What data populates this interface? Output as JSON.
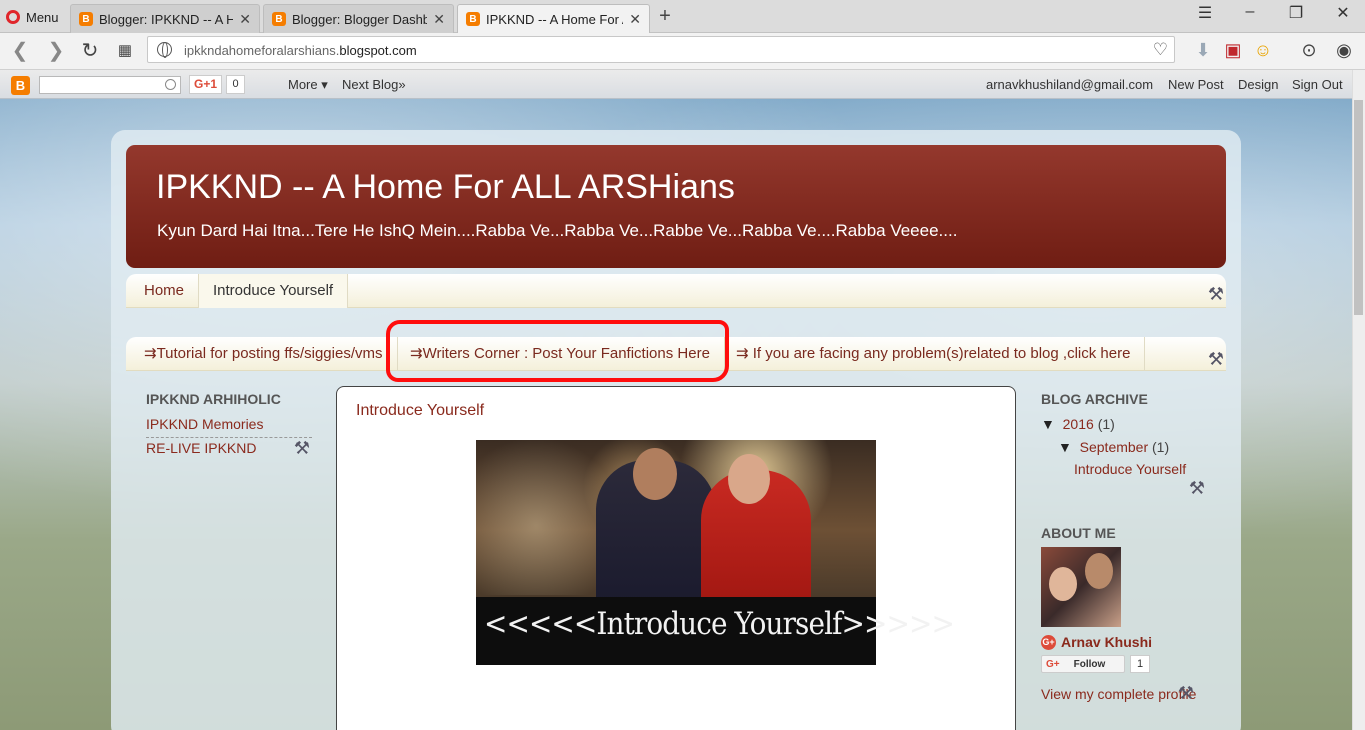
{
  "browser": {
    "menu_label": "Menu",
    "tabs": [
      {
        "title": "Blogger: IPKKND -- A Home For ALL ARSHians",
        "active": false
      },
      {
        "title": "Blogger: Blogger Dashboard",
        "active": false
      },
      {
        "title": "IPKKND -- A Home For ALL ARSHians",
        "active": true
      }
    ],
    "url_prefix": "ipkkndahomeforalarshians.",
    "url_domain": "blogspot.com",
    "icons": [
      "back-icon",
      "forward-icon",
      "reload-icon",
      "speed-dial-icon",
      "bookmark-heart-icon",
      "download-arrow-icon",
      "video-icon",
      "emoji-icon",
      "downloads-icon",
      "account-icon"
    ]
  },
  "blogger_navbar": {
    "gplus_label": "G+1",
    "gplus_count": "0",
    "more_label": "More ▾",
    "next_blog_label": "Next Blog»",
    "email": "arnavkhushiland@gmail.com",
    "new_post_label": "New Post",
    "design_label": "Design",
    "sign_out_label": "Sign Out"
  },
  "blog": {
    "title": "IPKKND -- A Home For ALL ARSHians",
    "description": "Kyun Dard Hai Itna...Tere He IshQ Mein....Rabba Ve...Rabba Ve...Rabbe Ve...Rabba Ve....Rabba Veeee....",
    "pages": [
      "Home",
      "Introduce Yourself"
    ],
    "links": [
      "⇉Tutorial for posting ffs/siggies/vms",
      "⇉Writers Corner : Post Your Fanfictions Here",
      "⇉ If you are facing any problem(s)related to blog ,click here"
    ]
  },
  "left_sidebar": {
    "title": "IPKKND ARHIHOLIC",
    "links": [
      "IPKKND Memories",
      "RE-LIVE IPKKND"
    ]
  },
  "post": {
    "title": "Introduce Yourself",
    "image_caption": "<<<<<Introduce Yourself>>>>>"
  },
  "right_sidebar": {
    "archive_title": "BLOG ARCHIVE",
    "year": "2016",
    "year_count": "(1)",
    "month": "September",
    "month_count": "(1)",
    "archive_post": "Introduce Yourself",
    "about_title": "ABOUT ME",
    "profile_name": "Arnav Khushi",
    "follow_label": "Follow",
    "follow_count": "1",
    "view_profile": "View my complete profile"
  },
  "colors": {
    "header_bg": "#7a2519",
    "link_color": "#8a2a1d",
    "annotation_red": "#ff0d0d",
    "blogger_orange": "#f57d00"
  }
}
